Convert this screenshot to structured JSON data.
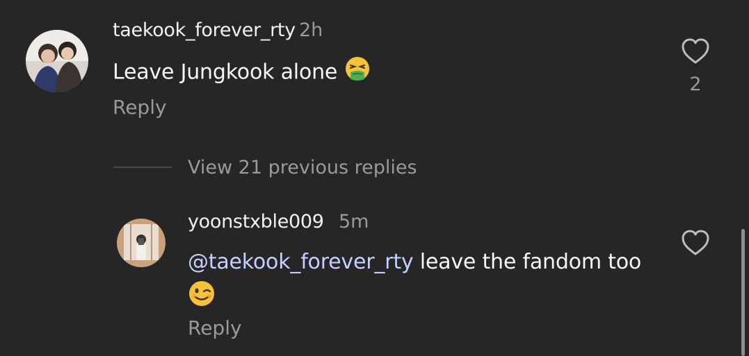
{
  "comment": {
    "username": "taekook_forever_rty",
    "time": "2h",
    "text": "Leave Jungkook alone",
    "emoji_icon": "nauseated-face-emoji",
    "reply_label": "Reply",
    "like_count": "2"
  },
  "thread": {
    "view_replies_label": "View 21 previous replies"
  },
  "reply": {
    "username": "yoonstxble009",
    "time": "5m",
    "mention": "@taekook_forever_rty",
    "text": " leave the fandom too",
    "emoji_icon": "winking-face-emoji",
    "reply_label": "Reply"
  },
  "colors": {
    "background": "#262626",
    "secondary_text": "#9a9a9a",
    "mention": "#c4d1ff"
  }
}
